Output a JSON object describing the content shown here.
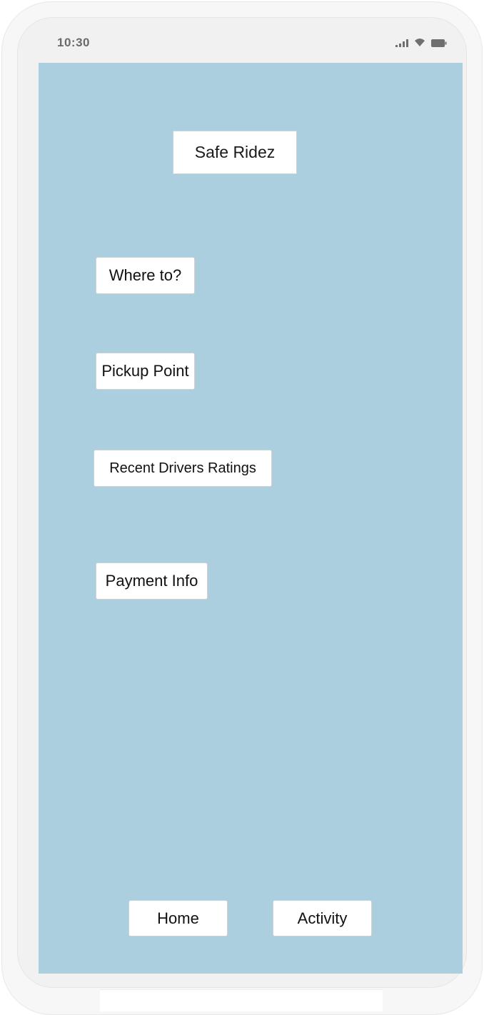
{
  "status_bar": {
    "time": "10:30",
    "icons": [
      "signal-icon",
      "wifi-icon",
      "battery-icon"
    ]
  },
  "app": {
    "title": "Safe Ridez",
    "background_color": "#abcfde"
  },
  "menu": {
    "where_to": "Where to?",
    "pickup_point": "Pickup Point",
    "recent_drivers_ratings": "Recent Drivers Ratings",
    "payment_info": "Payment Info"
  },
  "bottom_nav": {
    "home": "Home",
    "activity": "Activity"
  }
}
